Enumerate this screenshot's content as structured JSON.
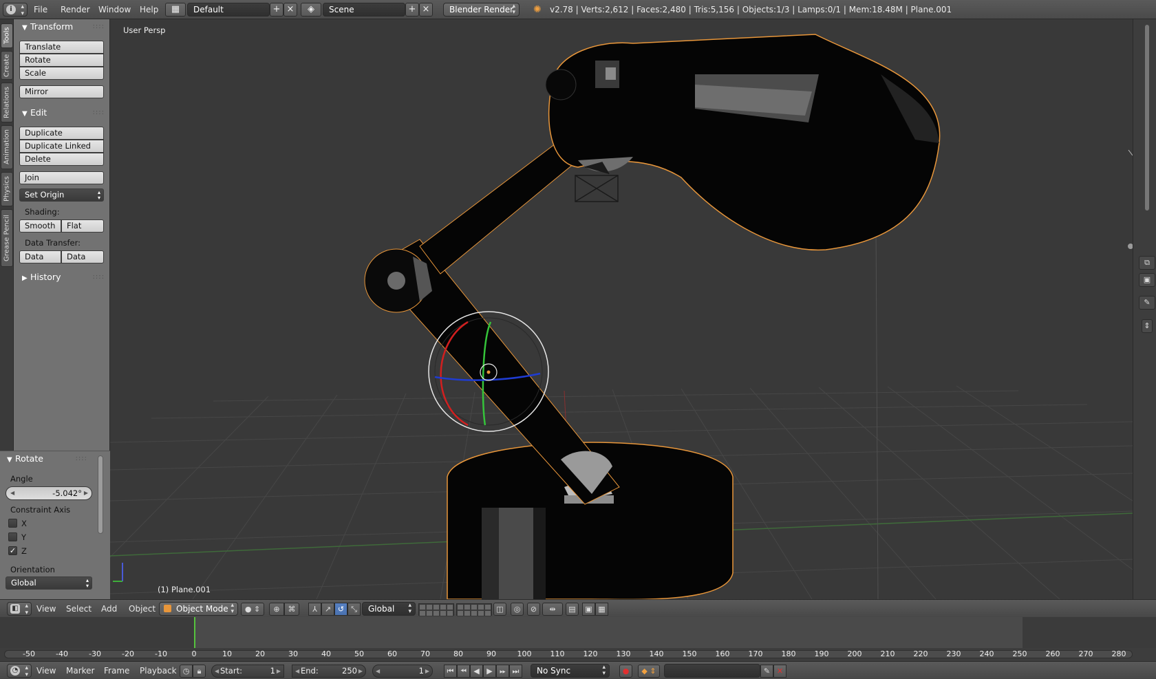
{
  "info_header": {
    "menus": [
      "File",
      "Render",
      "Window",
      "Help"
    ],
    "screen_layout": "Default",
    "scene": "Scene",
    "render_engine": "Blender Render",
    "stats": "v2.78 | Verts:2,612 | Faces:2,480 | Tris:5,156 | Objects:1/3 | Lamps:0/1 | Mem:18.48M | Plane.001"
  },
  "tool_tabs": [
    "Tools",
    "Create",
    "Relations",
    "Animation",
    "Physics",
    "Grease Pencil"
  ],
  "tool_shelf": {
    "transform": {
      "title": "Transform",
      "buttons": [
        "Translate",
        "Rotate",
        "Scale",
        "Mirror"
      ]
    },
    "edit": {
      "title": "Edit",
      "buttons": [
        "Duplicate",
        "Duplicate Linked",
        "Delete",
        "Join"
      ],
      "set_origin": "Set Origin",
      "shading_label": "Shading:",
      "shading_buttons": [
        "Smooth",
        "Flat"
      ],
      "data_transfer_label": "Data Transfer:",
      "data_transfer_buttons": [
        "Data",
        "Data Layo"
      ]
    },
    "history": {
      "title": "History"
    }
  },
  "redo_panel": {
    "title": "Rotate",
    "angle_label": "Angle",
    "angle_value": "-5.042°",
    "constraint_label": "Constraint Axis",
    "axes": [
      {
        "label": "X",
        "checked": false
      },
      {
        "label": "Y",
        "checked": false
      },
      {
        "label": "Z",
        "checked": true
      }
    ],
    "orientation_label": "Orientation",
    "orientation_value": "Global"
  },
  "viewport": {
    "view_name": "User Persp",
    "active_object": "(1) Plane.001"
  },
  "view3d_header": {
    "menus": [
      "View",
      "Select",
      "Add",
      "Object"
    ],
    "mode": "Object Mode",
    "transform_orientation": "Global"
  },
  "timeline": {
    "ticks": [
      -50,
      -40,
      -30,
      -20,
      -10,
      0,
      10,
      20,
      30,
      40,
      50,
      60,
      70,
      80,
      90,
      100,
      110,
      120,
      130,
      140,
      150,
      160,
      170,
      180,
      190,
      200,
      210,
      220,
      230,
      240,
      250,
      260,
      270,
      280
    ],
    "current_frame": 1
  },
  "timeline_header": {
    "menus": [
      "View",
      "Marker",
      "Frame",
      "Playback"
    ],
    "start_label": "Start:",
    "start_value": "1",
    "end_label": "End:",
    "end_value": "250",
    "frame_value": "1",
    "sync": "No Sync"
  },
  "colors": {
    "selection_outline": "#e8963a",
    "axis_x": "#d21f1f",
    "axis_y": "#35c43a",
    "axis_z": "#1f3cd2",
    "timeline_cursor": "#55c33d"
  }
}
